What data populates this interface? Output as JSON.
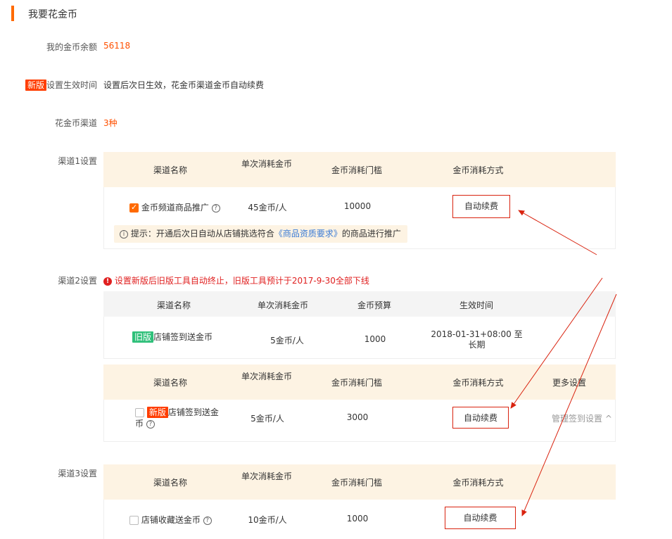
{
  "page": {
    "title": "我要花金币"
  },
  "balance": {
    "label": "我的金币余额",
    "value": "56118"
  },
  "effective": {
    "tag": "新版",
    "label": "设置生效时间",
    "value": "设置后次日生效，花金币渠道金币自动续费"
  },
  "channels_count": {
    "label": "花金币渠道",
    "value": "3种"
  },
  "channel1": {
    "label": "渠道1设置",
    "headers": [
      "渠道名称",
      "单次消耗金币",
      "金币消耗门槛",
      "金币消耗方式"
    ],
    "row": {
      "name": "金币频道商品推广",
      "cost": "45金币/人",
      "threshold": "10000",
      "mode": "自动续费",
      "checked": true
    },
    "tip_prefix": "提示：开通后次日自动从店铺挑选符合",
    "tip_link": "《商品资质要求》",
    "tip_suffix": "的商品进行推广"
  },
  "channel2": {
    "label": "渠道2设置",
    "warning": "设置新版后旧版工具自动终止，旧版工具预计于2017-9-30全部下线",
    "old_headers": [
      "渠道名称",
      "单次消耗金币",
      "金币预算",
      "生效时间"
    ],
    "old_row": {
      "tag": "旧版",
      "name": "店铺签到送金币",
      "cost": "5金币/人",
      "budget": "1000",
      "time": "2018-01-31+08:00 至 长期"
    },
    "headers": [
      "渠道名称",
      "单次消耗金币",
      "金币消耗门槛",
      "金币消耗方式",
      "更多设置"
    ],
    "row": {
      "tag": "新版",
      "name": "店铺签到送金币",
      "cost": "5金币/人",
      "threshold": "3000",
      "mode": "自动续费",
      "more": "管理签到设置 ^",
      "checked": false
    }
  },
  "channel3": {
    "label": "渠道3设置",
    "headers": [
      "渠道名称",
      "单次消耗金币",
      "金币消耗门槛",
      "金币消耗方式"
    ],
    "row": {
      "name": "店铺收藏送金币",
      "cost": "10金币/人",
      "threshold": "1000",
      "mode": "自动续费",
      "checked": false
    }
  },
  "colors": {
    "accent": "#ff6a00",
    "annotation": "#d9230f",
    "header_bg": "#fdf3e3"
  }
}
